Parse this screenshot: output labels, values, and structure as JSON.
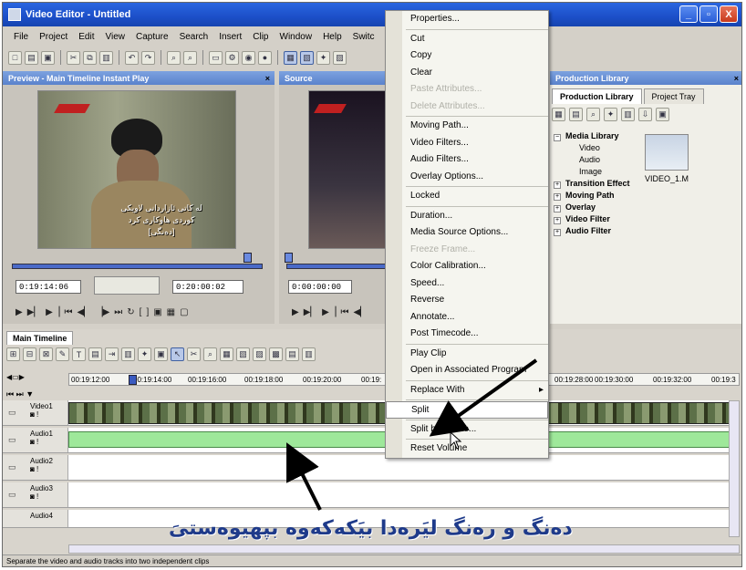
{
  "window": {
    "title": "Video Editor - Untitled",
    "controls": [
      "_",
      "▫",
      "X"
    ]
  },
  "menubar": [
    "File",
    "Project",
    "Edit",
    "View",
    "Capture",
    "Search",
    "Insert",
    "Clip",
    "Window",
    "Help",
    "Switc"
  ],
  "preview": {
    "title": "Preview - Main Timeline Instant Play",
    "close": "×",
    "subtitle_line1": "له کاتی ئازاردانی لاویکی",
    "subtitle_line2": "کوردی هاوکاری کرد",
    "subtitle_line3": "[ده‌نگی]",
    "timecode": "0:19:14:06",
    "duration": "0:20:00:02"
  },
  "source": {
    "title": "Source",
    "timecode": "0:00:00:00"
  },
  "library": {
    "title": "Production Library",
    "tabs": [
      "Production Library",
      "Project Tray"
    ],
    "tree": [
      {
        "label": "Media Library",
        "bold": true
      },
      {
        "label": "Video",
        "indent": 2
      },
      {
        "label": "Audio",
        "indent": 2
      },
      {
        "label": "Image",
        "indent": 2
      },
      {
        "label": "Transition Effect",
        "bold": true
      },
      {
        "label": "Moving Path",
        "bold": true
      },
      {
        "label": "Overlay",
        "bold": true
      },
      {
        "label": "Video Filter",
        "bold": true
      },
      {
        "label": "Audio Filter",
        "bold": true
      }
    ],
    "clip": "VIDEO_1.M"
  },
  "timeline": {
    "title": "Main Timeline",
    "ruler": [
      "00:19:12:00",
      "00:19:14:00",
      "00:19:16:00",
      "00:19:18:00",
      "00:19:20:00",
      "00:19:",
      "00:19:28:00",
      "00:19:30:00",
      "00:19:32:00",
      "00:19:3"
    ],
    "tracks": [
      "Video1",
      "Audio1",
      "Audio2",
      "Audio3",
      "Audio4"
    ]
  },
  "context_menu": [
    "Properties...",
    "---",
    "Cut",
    "Copy",
    "Clear",
    "Paste Attributes...",
    "Delete Attributes...",
    "---",
    "Moving Path...",
    "Video Filters...",
    "Audio Filters...",
    "Overlay Options...",
    "---",
    "Locked",
    "---",
    "Duration...",
    "Media Source Options...",
    "Freeze Frame...",
    "Color Calibration...",
    "Speed...",
    "Reverse",
    "Annotate...",
    "Post Timecode...",
    "---",
    "Play Clip",
    "Open in Associated Program",
    "---",
    "Replace With",
    "---",
    "Split",
    "---",
    "Split by Scene...",
    "---",
    "Reset Volume"
  ],
  "status": "Separate the video and audio tracks into two independent clips",
  "annotation": "ده‌نگ و ره‌نگ لیَره‌دا بیَکه‌که‌وه‌ بپهیوه‌ستیَ"
}
